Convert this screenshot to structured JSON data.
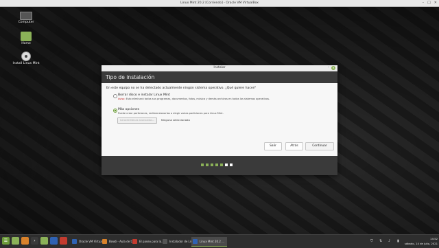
{
  "vm": {
    "title": "Linux Mint 20.2 [Corriendo] - Oracle VM VirtualBox",
    "controls": [
      "–",
      "□",
      "✕"
    ]
  },
  "desktop": {
    "icons": [
      {
        "label": "Computer",
        "icon": "computer-icon"
      },
      {
        "label": "Home",
        "icon": "folder-icon"
      },
      {
        "label": "Install Linux Mint",
        "icon": "disc-icon"
      }
    ]
  },
  "installer": {
    "window_title": "Instalar",
    "controls": {
      "minimize": "–",
      "close": "✕"
    },
    "header_title": "Tipo de instalación",
    "question": "En este equipo no se ha detectado actualmente ningún sistema operativo. ¿Qué quiere hacer?",
    "option_erase": {
      "label": "Borrar disco e instalar Linux Mint",
      "note_prefix": "Aviso:",
      "note_text": " Esto eliminará todos sus programas, documentos, fotos, música y demás archivos en todos los sistemas operativos.",
      "advanced_button": "Características avanzadas...",
      "advanced_status": "Ninguna seleccionada",
      "selected": false
    },
    "option_more": {
      "label": "Más opciones",
      "description": "Puede crear particiones, redimensionarlas o elegir varias particiones para Linux Mint.",
      "selected": true
    },
    "buttons": {
      "quit": "Salir",
      "back": "Atrás",
      "continue": "Continuar"
    },
    "progress": {
      "total_steps": 7,
      "current_step": 6
    }
  },
  "taskbar": {
    "tasks": [
      {
        "label": "Oracle VM Virtua...",
        "color": "#2f62b3"
      },
      {
        "label": "Bowti - Aula de t...",
        "color": "#d9822b"
      },
      {
        "label": "El paseo para la...",
        "color": "#c33b2f"
      },
      {
        "label": "Instalador de Lin...",
        "color": "#555555"
      },
      {
        "label": "Linux Mint 20.2 ...",
        "color": "#2f62b3"
      }
    ],
    "clock_time": "14:52",
    "clock_date": "sábado, 14 de julio, 2021"
  },
  "colors": {
    "accent": "#8bb158",
    "header": "#3a3a3a",
    "warning": "#c01c1c"
  }
}
